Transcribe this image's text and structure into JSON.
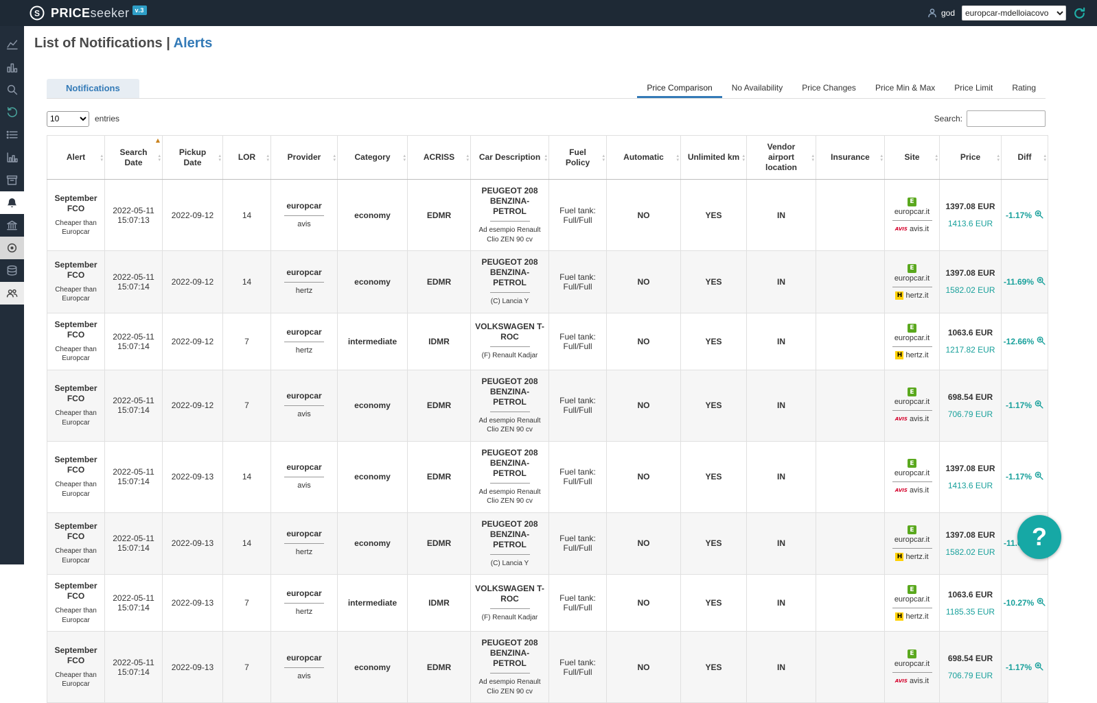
{
  "colors": {
    "accent_teal": "#18a09b",
    "accent_blue": "#337ab7",
    "topbar_bg": "#1e2935",
    "europcar_green": "#5aa81e",
    "hertz_yellow": "#ffd100",
    "avis_red": "#d4002a"
  },
  "topbar": {
    "brand_bold": "PRICE",
    "brand_light": "seeker",
    "version_badge": "v.3",
    "user": "god",
    "account": "europcar-mdelloiacovo"
  },
  "sidebar": {
    "icons": [
      "line-chart",
      "column-chart",
      "search",
      "history",
      "list",
      "axis-chart",
      "archive",
      "alerts-bell",
      "bank",
      "target",
      "database",
      "users"
    ],
    "active_icon": "alerts-bell"
  },
  "page": {
    "title": "List of Notifications |",
    "title_accent": "Alerts"
  },
  "tabs": {
    "main_label": "Notifications",
    "filters": [
      "Price Comparison",
      "No Availability",
      "Price Changes",
      "Price Min & Max",
      "Price Limit",
      "Rating"
    ],
    "active_filter": "Price Comparison"
  },
  "controls": {
    "entries_value": "10",
    "entries_label": "entries",
    "search_label": "Search:",
    "search_value": ""
  },
  "table": {
    "columns": [
      "Alert",
      "Search Date",
      "Pickup Date",
      "LOR",
      "Provider",
      "Category",
      "ACRISS",
      "Car Description",
      "Fuel Policy",
      "Automatic",
      "Unlimited km",
      "Vendor airport location",
      "Insurance",
      "Site",
      "Price",
      "Diff"
    ],
    "sorted_column": "Search Date",
    "sort_direction": "asc",
    "site_logos": {
      "europcar": "E",
      "avis": "AVIS",
      "hertz": "H"
    },
    "rows": [
      {
        "alert_title": "September FCO",
        "alert_sub": "Cheaper than Europcar",
        "search_date": "2022-05-11 15:07:13",
        "pickup_date": "2022-09-12",
        "lor": "14",
        "provider_main": "europcar",
        "provider_comp": "avis",
        "category": "economy",
        "acriss": "EDMR",
        "car_main": "PEUGEOT 208 BENZINA-PETROL",
        "car_sub": "Ad esempio Renault Clio ZEN 90 cv",
        "fuel_policy": "Fuel tank: Full/Full",
        "automatic": "NO",
        "unlimited_km": "YES",
        "vendor_airport_location": "IN",
        "insurance": "",
        "site_main": "europcar.it",
        "site_comp": "avis.it",
        "comp_brand": "avis",
        "price_main": "1397.08 EUR",
        "price_comp": "1413.6 EUR",
        "diff": "-1.17%"
      },
      {
        "alert_title": "September FCO",
        "alert_sub": "Cheaper than Europcar",
        "search_date": "2022-05-11 15:07:14",
        "pickup_date": "2022-09-12",
        "lor": "14",
        "provider_main": "europcar",
        "provider_comp": "hertz",
        "category": "economy",
        "acriss": "EDMR",
        "car_main": "PEUGEOT 208 BENZINA-PETROL",
        "car_sub": "(C) Lancia Y",
        "fuel_policy": "Fuel tank: Full/Full",
        "automatic": "NO",
        "unlimited_km": "YES",
        "vendor_airport_location": "IN",
        "insurance": "",
        "site_main": "europcar.it",
        "site_comp": "hertz.it",
        "comp_brand": "hertz",
        "price_main": "1397.08 EUR",
        "price_comp": "1582.02 EUR",
        "diff": "-11.69%"
      },
      {
        "alert_title": "September FCO",
        "alert_sub": "Cheaper than Europcar",
        "search_date": "2022-05-11 15:07:14",
        "pickup_date": "2022-09-12",
        "lor": "7",
        "provider_main": "europcar",
        "provider_comp": "hertz",
        "category": "intermediate",
        "acriss": "IDMR",
        "car_main": "VOLKSWAGEN T-ROC",
        "car_sub": "(F) Renault Kadjar",
        "fuel_policy": "Fuel tank: Full/Full",
        "automatic": "NO",
        "unlimited_km": "YES",
        "vendor_airport_location": "IN",
        "insurance": "",
        "site_main": "europcar.it",
        "site_comp": "hertz.it",
        "comp_brand": "hertz",
        "price_main": "1063.6 EUR",
        "price_comp": "1217.82 EUR",
        "diff": "-12.66%"
      },
      {
        "alert_title": "September FCO",
        "alert_sub": "Cheaper than Europcar",
        "search_date": "2022-05-11 15:07:14",
        "pickup_date": "2022-09-12",
        "lor": "7",
        "provider_main": "europcar",
        "provider_comp": "avis",
        "category": "economy",
        "acriss": "EDMR",
        "car_main": "PEUGEOT 208 BENZINA-PETROL",
        "car_sub": "Ad esempio Renault Clio ZEN 90 cv",
        "fuel_policy": "Fuel tank: Full/Full",
        "automatic": "NO",
        "unlimited_km": "YES",
        "vendor_airport_location": "IN",
        "insurance": "",
        "site_main": "europcar.it",
        "site_comp": "avis.it",
        "comp_brand": "avis",
        "price_main": "698.54 EUR",
        "price_comp": "706.79 EUR",
        "diff": "-1.17%"
      },
      {
        "alert_title": "September FCO",
        "alert_sub": "Cheaper than Europcar",
        "search_date": "2022-05-11 15:07:14",
        "pickup_date": "2022-09-13",
        "lor": "14",
        "provider_main": "europcar",
        "provider_comp": "avis",
        "category": "economy",
        "acriss": "EDMR",
        "car_main": "PEUGEOT 208 BENZINA-PETROL",
        "car_sub": "Ad esempio Renault Clio ZEN 90 cv",
        "fuel_policy": "Fuel tank: Full/Full",
        "automatic": "NO",
        "unlimited_km": "YES",
        "vendor_airport_location": "IN",
        "insurance": "",
        "site_main": "europcar.it",
        "site_comp": "avis.it",
        "comp_brand": "avis",
        "price_main": "1397.08 EUR",
        "price_comp": "1413.6 EUR",
        "diff": "-1.17%"
      },
      {
        "alert_title": "September FCO",
        "alert_sub": "Cheaper than Europcar",
        "search_date": "2022-05-11 15:07:14",
        "pickup_date": "2022-09-13",
        "lor": "14",
        "provider_main": "europcar",
        "provider_comp": "hertz",
        "category": "economy",
        "acriss": "EDMR",
        "car_main": "PEUGEOT 208 BENZINA-PETROL",
        "car_sub": "(C) Lancia Y",
        "fuel_policy": "Fuel tank: Full/Full",
        "automatic": "NO",
        "unlimited_km": "YES",
        "vendor_airport_location": "IN",
        "insurance": "",
        "site_main": "europcar.it",
        "site_comp": "hertz.it",
        "comp_brand": "hertz",
        "price_main": "1397.08 EUR",
        "price_comp": "1582.02 EUR",
        "diff": "-11.69%"
      },
      {
        "alert_title": "September FCO",
        "alert_sub": "Cheaper than Europcar",
        "search_date": "2022-05-11 15:07:14",
        "pickup_date": "2022-09-13",
        "lor": "7",
        "provider_main": "europcar",
        "provider_comp": "hertz",
        "category": "intermediate",
        "acriss": "IDMR",
        "car_main": "VOLKSWAGEN T-ROC",
        "car_sub": "(F) Renault Kadjar",
        "fuel_policy": "Fuel tank: Full/Full",
        "automatic": "NO",
        "unlimited_km": "YES",
        "vendor_airport_location": "IN",
        "insurance": "",
        "site_main": "europcar.it",
        "site_comp": "hertz.it",
        "comp_brand": "hertz",
        "price_main": "1063.6 EUR",
        "price_comp": "1185.35 EUR",
        "diff": "-10.27%"
      },
      {
        "alert_title": "September FCO",
        "alert_sub": "Cheaper than Europcar",
        "search_date": "2022-05-11 15:07:14",
        "pickup_date": "2022-09-13",
        "lor": "7",
        "provider_main": "europcar",
        "provider_comp": "avis",
        "category": "economy",
        "acriss": "EDMR",
        "car_main": "PEUGEOT 208 BENZINA-PETROL",
        "car_sub": "Ad esempio Renault Clio ZEN 90 cv",
        "fuel_policy": "Fuel tank: Full/Full",
        "automatic": "NO",
        "unlimited_km": "YES",
        "vendor_airport_location": "IN",
        "insurance": "",
        "site_main": "europcar.it",
        "site_comp": "avis.it",
        "comp_brand": "avis",
        "price_main": "698.54 EUR",
        "price_comp": "706.79 EUR",
        "diff": "-1.17%"
      }
    ]
  },
  "help": {
    "label": "?"
  }
}
